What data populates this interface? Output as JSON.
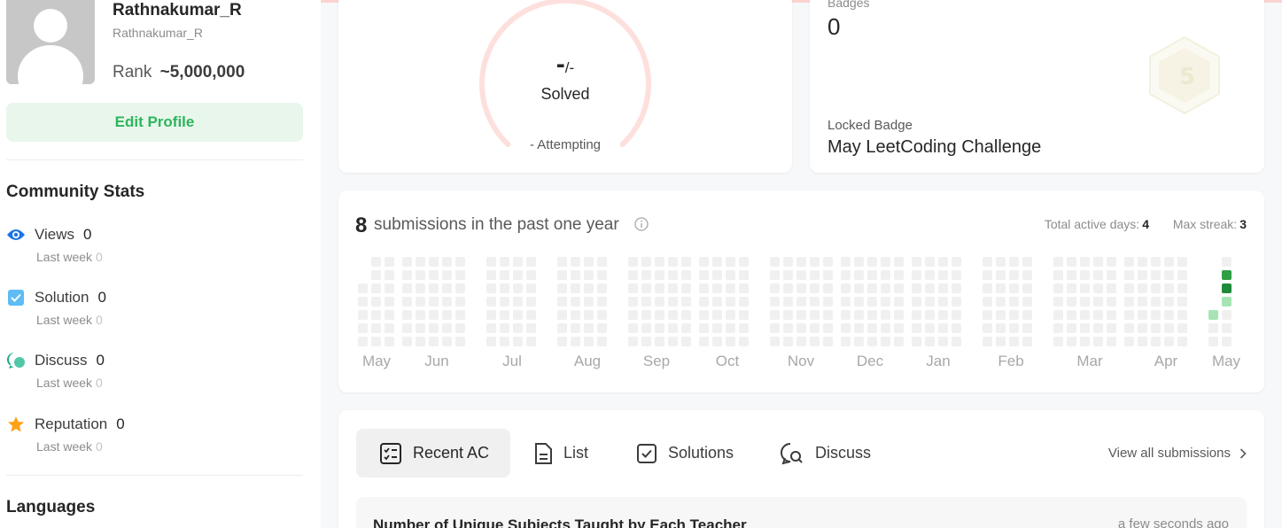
{
  "profile": {
    "real_name": "Rathnakumar_R",
    "username": "Rathnakumar_R",
    "rank_label": "Rank",
    "rank_value": "~5,000,000",
    "edit_label": "Edit Profile"
  },
  "community": {
    "title": "Community Stats",
    "stats": [
      {
        "label": "Views",
        "value": "0",
        "sub_label": "Last week",
        "sub_value": "0",
        "icon": "eye-icon",
        "color": "#1a73e8"
      },
      {
        "label": "Solution",
        "value": "0",
        "sub_label": "Last week",
        "sub_value": "0",
        "icon": "check-square-icon",
        "color": "#5dbcf4"
      },
      {
        "label": "Discuss",
        "value": "0",
        "sub_label": "Last week",
        "sub_value": "0",
        "icon": "discuss-icon",
        "color": "#1aa886"
      },
      {
        "label": "Reputation",
        "value": "0",
        "sub_label": "Last week",
        "sub_value": "0",
        "icon": "star-icon",
        "color": "#ffa116"
      }
    ]
  },
  "languages": {
    "title": "Languages"
  },
  "solved": {
    "count": "-",
    "total": "/-",
    "label": "Solved",
    "attempting": "- Attempting"
  },
  "badges": {
    "title": "Badges",
    "count": "0",
    "locked_label": "Locked Badge",
    "locked_name": "May LeetCoding Challenge",
    "badge_icon": "5-hexagon-badge-icon"
  },
  "calendar": {
    "count": "8",
    "text": "submissions in the past one year",
    "active_label": "Total active days:",
    "active_value": "4",
    "streak_label": "Max streak:",
    "streak_value": "3",
    "months": [
      "May",
      "Jun",
      "Jul",
      "Aug",
      "Sep",
      "Oct",
      "Nov",
      "Dec",
      "Jan",
      "Feb",
      "Mar",
      "Apr",
      "May"
    ],
    "colors": {
      "empty": "#f0f0f0",
      "light": "#a6e5b3",
      "dark": "#1f8a3a",
      "mid": "#2ea043"
    }
  },
  "tabs": {
    "items": [
      "Recent AC",
      "List",
      "Solutions",
      "Discuss"
    ],
    "view_all": "View all submissions"
  },
  "recent": {
    "title": "Number of Unique Subjects Taught by Each Teacher",
    "time": "a few seconds ago"
  }
}
